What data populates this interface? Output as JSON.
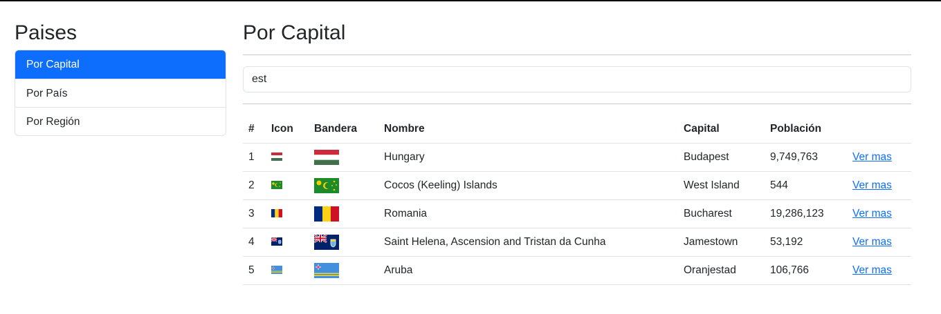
{
  "sidebar": {
    "title": "Paises",
    "items": [
      {
        "label": "Por Capital",
        "active": true
      },
      {
        "label": "Por País",
        "active": false
      },
      {
        "label": "Por Región",
        "active": false
      }
    ]
  },
  "main": {
    "title": "Por Capital",
    "search": {
      "value": "est"
    },
    "table": {
      "headers": {
        "num": "#",
        "icon": "Icon",
        "flag": "Bandera",
        "name": "Nombre",
        "capital": "Capital",
        "population": "Población"
      },
      "link_label": "Ver mas",
      "rows": [
        {
          "num": "1",
          "name": "Hungary",
          "capital": "Budapest",
          "population": "9,749,763",
          "flag_icon": "hungary-flag-icon"
        },
        {
          "num": "2",
          "name": "Cocos (Keeling) Islands",
          "capital": "West Island",
          "population": "544",
          "flag_icon": "cocos-islands-flag-icon"
        },
        {
          "num": "3",
          "name": "Romania",
          "capital": "Bucharest",
          "population": "19,286,123",
          "flag_icon": "romania-flag-icon"
        },
        {
          "num": "4",
          "name": "Saint Helena, Ascension and Tristan da Cunha",
          "capital": "Jamestown",
          "population": "53,192",
          "flag_icon": "saint-helena-flag-icon"
        },
        {
          "num": "5",
          "name": "Aruba",
          "capital": "Oranjestad",
          "population": "106,766",
          "flag_icon": "aruba-flag-icon"
        }
      ]
    }
  },
  "colors": {
    "accent": "#0d6efd",
    "link": "#0d6efd",
    "border": "#dee2e6"
  }
}
